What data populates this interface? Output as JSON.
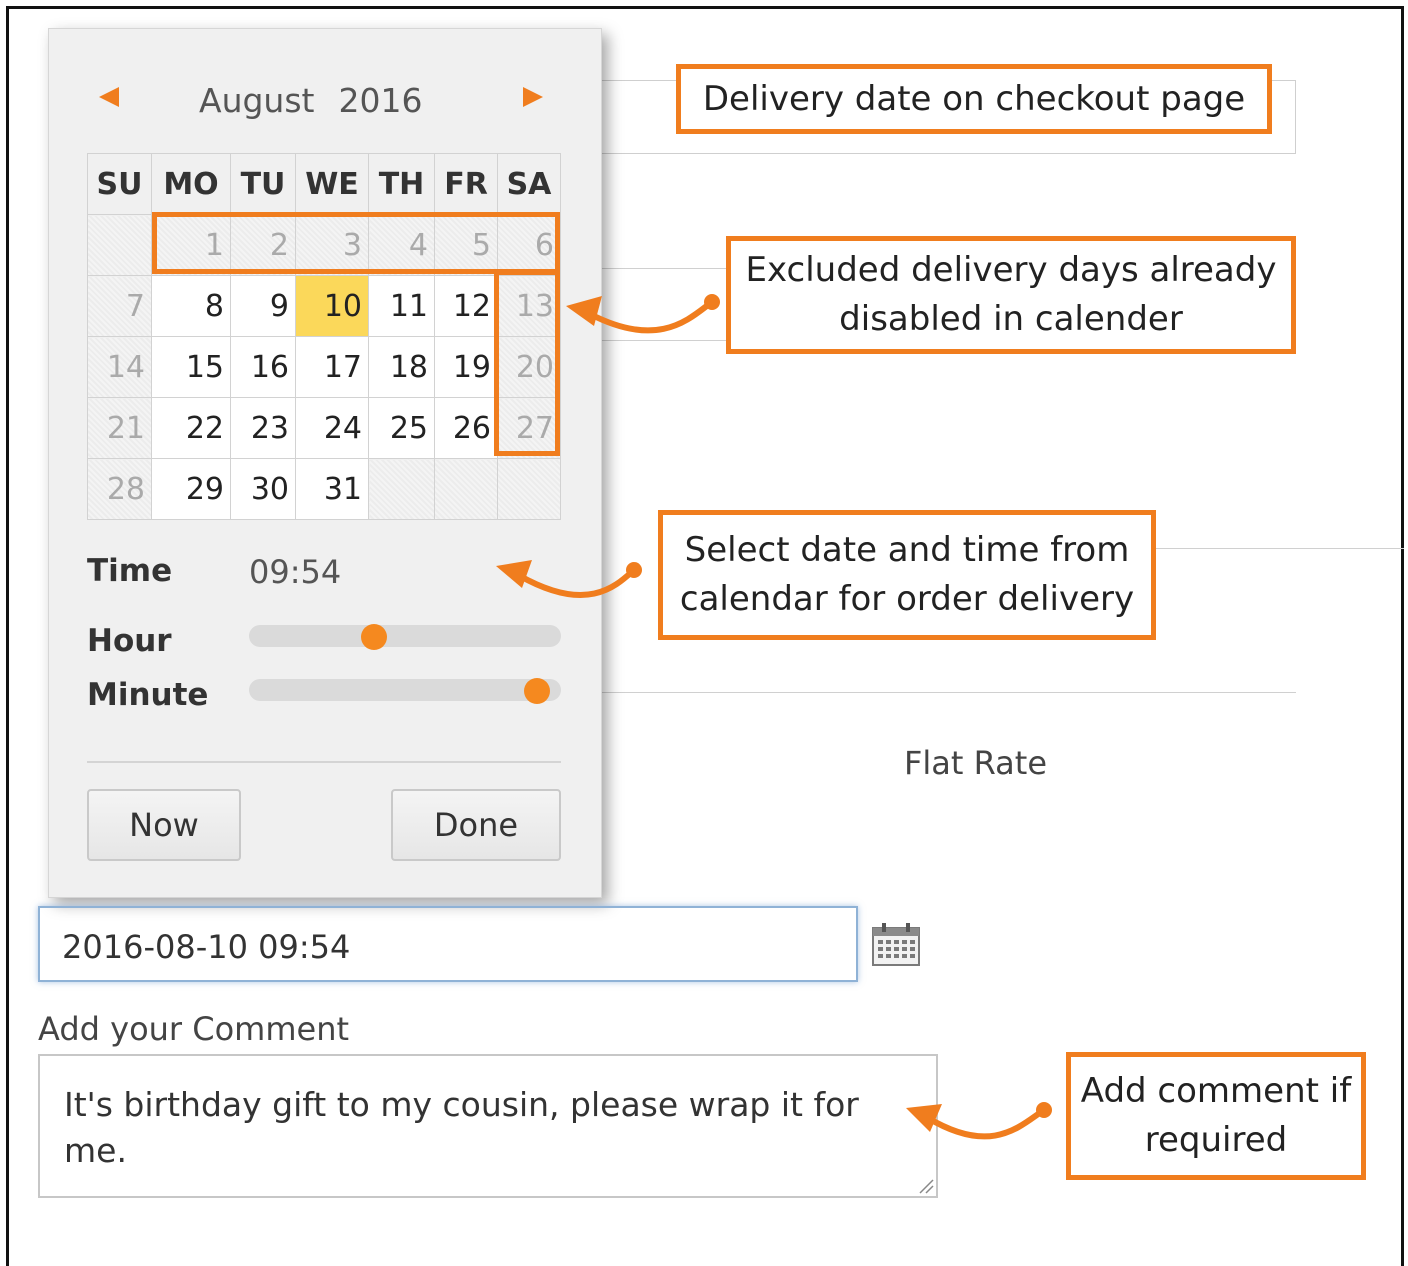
{
  "calendar": {
    "month": "August",
    "year": "2016",
    "weekdays": [
      "SU",
      "MO",
      "TU",
      "WE",
      "TH",
      "FR",
      "SA"
    ],
    "weeks": [
      [
        "",
        "1",
        "2",
        "3",
        "4",
        "5",
        "6"
      ],
      [
        "7",
        "8",
        "9",
        "10",
        "11",
        "12",
        "13"
      ],
      [
        "14",
        "15",
        "16",
        "17",
        "18",
        "19",
        "20"
      ],
      [
        "21",
        "22",
        "23",
        "24",
        "25",
        "26",
        "27"
      ],
      [
        "28",
        "29",
        "30",
        "31",
        "",
        "",
        ""
      ]
    ],
    "selected_day": "10",
    "disabled_days": [
      "1",
      "2",
      "3",
      "4",
      "5",
      "6",
      "7",
      "13",
      "14",
      "20",
      "21",
      "27",
      "28"
    ]
  },
  "time": {
    "label": "Time",
    "value": "09:54",
    "hour_label": "Hour",
    "minute_label": "Minute",
    "hour_fraction": 0.39,
    "minute_fraction": 0.96
  },
  "buttons": {
    "now": "Now",
    "done": "Done"
  },
  "form": {
    "datetime_value": "2016-08-10 09:54",
    "shipping_text": "Flat Rate",
    "comment_label": "Add your Comment",
    "comment_text": "It's birthday gift to my cousin, please wrap it for me."
  },
  "callouts": {
    "checkout": "Delivery date on checkout page",
    "excluded": "Excluded delivery days already disabled in calender",
    "select": "Select date and time from calendar for order delivery",
    "comment": "Add comment if required"
  },
  "colors": {
    "accent": "#f07d1e",
    "today": "#fbd85a"
  }
}
